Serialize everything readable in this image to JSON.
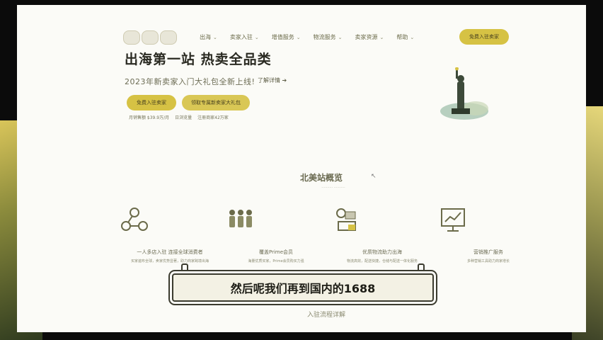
{
  "nav": {
    "links": [
      {
        "label": "出海",
        "icon": "chevron-down-icon"
      },
      {
        "label": "卖家入驻",
        "icon": "chevron-down-icon"
      },
      {
        "label": "增值服务",
        "icon": "chevron-down-icon"
      },
      {
        "label": "物流服务",
        "icon": "chevron-down-icon"
      },
      {
        "label": "卖家资源",
        "icon": "chevron-down-icon"
      },
      {
        "label": "帮助",
        "icon": "chevron-down-icon"
      }
    ],
    "cta": "免费入驻卖家"
  },
  "hero": {
    "title": "出海第一站 热卖全品类",
    "subtitle": "2023年新卖家入门大礼包全新上线!",
    "link": "了解详情 ➔",
    "btn_primary": "免费入驻卖家",
    "btn_secondary": "领取专属新卖家大礼包",
    "stats": [
      "月销售额 $39.9万/月",
      "日浏览量",
      "注册商家42万家"
    ]
  },
  "section": {
    "title": "北美站概览",
    "subtitle": "·········· ··········"
  },
  "features": [
    {
      "icon": "network-icon",
      "title": "一人多店入驻 连接全球消费者",
      "desc": "买家遍布全球，卖家优势显著，助力商家跨境出海"
    },
    {
      "icon": "people-icon",
      "title": "覆盖Prime会员",
      "desc": "海量优质买家，Prime会员购买力强"
    },
    {
      "icon": "logistics-icon",
      "title": "优质物流助力出海",
      "desc": "物流高效，配送快捷，仓储与配送一体化服务"
    },
    {
      "icon": "growth-chart-icon",
      "title": "营销推广服务",
      "desc": "多种营销工具助力商家增长"
    }
  ],
  "caption": "然后呢我们再到国内的1688",
  "bottom_title": "入驻流程详解",
  "colors": {
    "accent": "#d6c244",
    "page_bg": "#fbfbf7"
  }
}
